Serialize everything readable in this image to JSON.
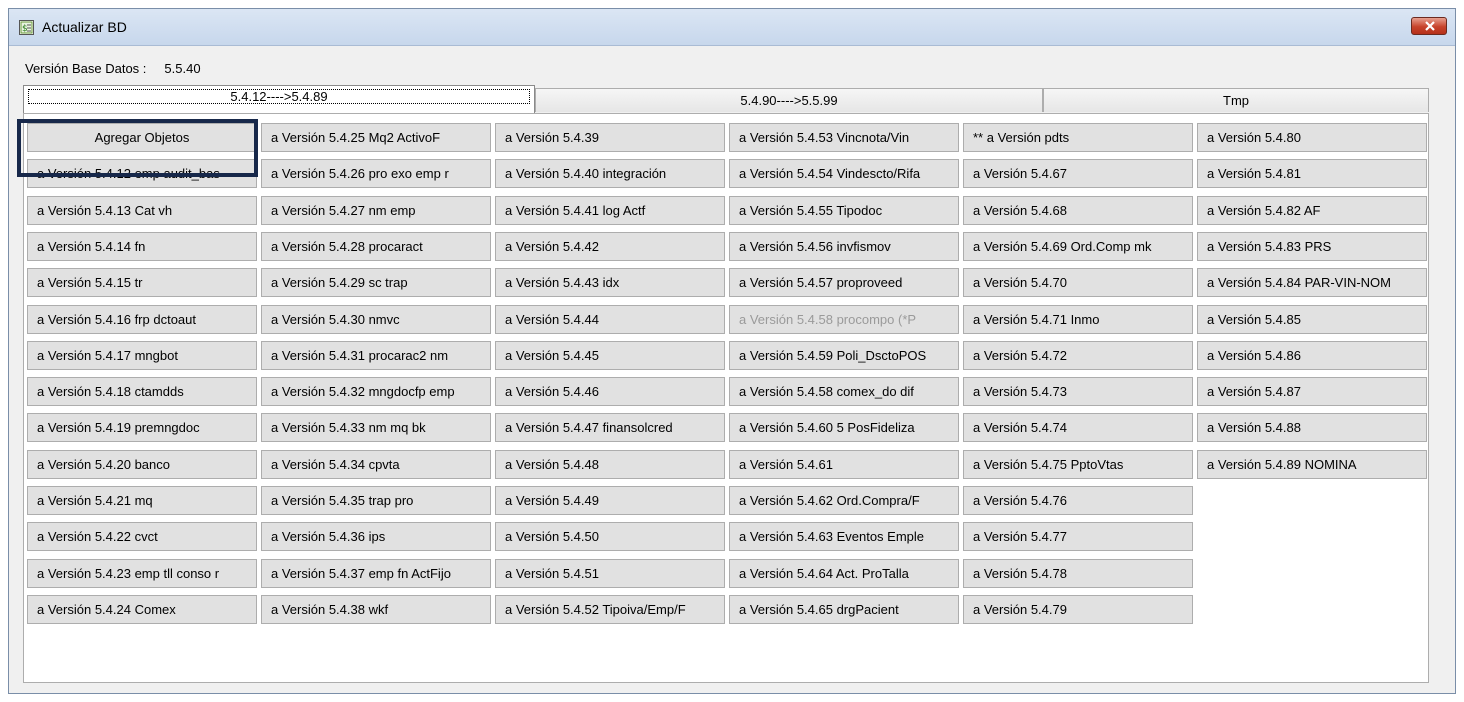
{
  "window": {
    "title": "Actualizar BD",
    "icon": "database-update-icon",
    "close_icon": "close-icon"
  },
  "version": {
    "label": "Versión Base Datos :",
    "value": "5.5.40"
  },
  "tabs": [
    {
      "label": "5.4.12---->5.4.89",
      "active": true
    },
    {
      "label": "5.4.90---->5.5.99",
      "active": false
    },
    {
      "label": "Tmp",
      "active": false
    }
  ],
  "columns": [
    [
      "Agregar Objetos",
      "a Versión 5.4.12 emp audit_bas",
      "a Versión 5.4.13 Cat vh",
      "a Versión 5.4.14 fn",
      "a Versión 5.4.15 tr",
      "a Versión 5.4.16 frp dctoaut",
      "a Versión 5.4.17 mngbot",
      "a Versión 5.4.18 ctamdds",
      "a Versión 5.4.19 premngdoc",
      "a Versión 5.4.20 banco",
      "a Versión 5.4.21 mq",
      "a Versión 5.4.22 cvct",
      "a Versión 5.4.23 emp tll conso r",
      "a Versión 5.4.24 Comex"
    ],
    [
      "a Versión 5.4.25 Mq2 ActivoF",
      "a Versión 5.4.26 pro exo emp r",
      "a Versión 5.4.27 nm emp",
      "a Versión 5.4.28 procaract",
      "a Versión 5.4.29 sc trap",
      "a Versión 5.4.30 nmvc",
      "a Versión 5.4.31 procarac2 nm",
      "a Versión 5.4.32 mngdocfp emp",
      "a Versión 5.4.33 nm  mq bk",
      "a Versión 5.4.34 cpvta",
      "a Versión 5.4.35 trap pro",
      "a Versión 5.4.36 ips",
      "a Versión 5.4.37 emp fn ActFijo",
      "a Versión 5.4.38 wkf"
    ],
    [
      "a Versión 5.4.39",
      "a Versión 5.4.40 integración",
      "a Versión 5.4.41 log Actf",
      "a Versión 5.4.42",
      "a Versión 5.4.43 idx",
      "a Versión 5.4.44",
      "a Versión 5.4.45",
      "a Versión 5.4.46",
      "a Versión 5.4.47 finansolcred",
      "a Versión 5.4.48",
      "a Versión 5.4.49",
      "a Versión 5.4.50",
      "a Versión 5.4.51",
      "a Versión 5.4.52 Tipoiva/Emp/F"
    ],
    [
      "a Versión 5.4.53 Vincnota/Vin",
      "a Versión 5.4.54 Vindescto/Rifa",
      "a Versión 5.4.55 Tipodoc",
      "a Versión 5.4.56 invfismov",
      "a Versión 5.4.57 proproveed",
      "a Versión 5.4.58 procompo (*P",
      "a Versión 5.4.59 Poli_DsctoPOS",
      "a Versión 5.4.58 comex_do dif",
      "a Versión 5.4.60 5 PosFideliza",
      "a Versión 5.4.61",
      "a Versión 5.4.62 Ord.Compra/F",
      "a Versión 5.4.63 Eventos Emple",
      "a Versión 5.4.64  Act. ProTalla",
      "a Versión 5.4.65 drgPacient"
    ],
    [
      "** a Versión pdts",
      "a Versión 5.4.67",
      "a Versión 5.4.68",
      "a Versión 5.4.69 Ord.Comp mk",
      "a Versión 5.4.70",
      "a Versión 5.4.71 Inmo",
      "a Versión 5.4.72",
      "a Versión 5.4.73",
      "a Versión 5.4.74",
      "a Versión 5.4.75 PptoVtas",
      "a Versión 5.4.76",
      "a Versión 5.4.77",
      "a Versión 5.4.78",
      "a Versión 5.4.79"
    ],
    [
      "a Versión 5.4.80",
      "a Versión 5.4.81",
      "a Versión 5.4.82 AF",
      "a Versión 5.4.83 PRS",
      "a Versión 5.4.84 PAR-VIN-NOM",
      "a Versión 5.4.85",
      "a Versión 5.4.86",
      "a Versión 5.4.87",
      "a Versión 5.4.88",
      "a Versión 5.4.89 NOMINA"
    ]
  ],
  "disabled_buttons": [
    "a Versión 5.4.58 procompo (*P"
  ],
  "colors": {
    "highlight_border": "#17284a",
    "button_face": "#e1e1e1",
    "close_button": "#c7432b"
  }
}
